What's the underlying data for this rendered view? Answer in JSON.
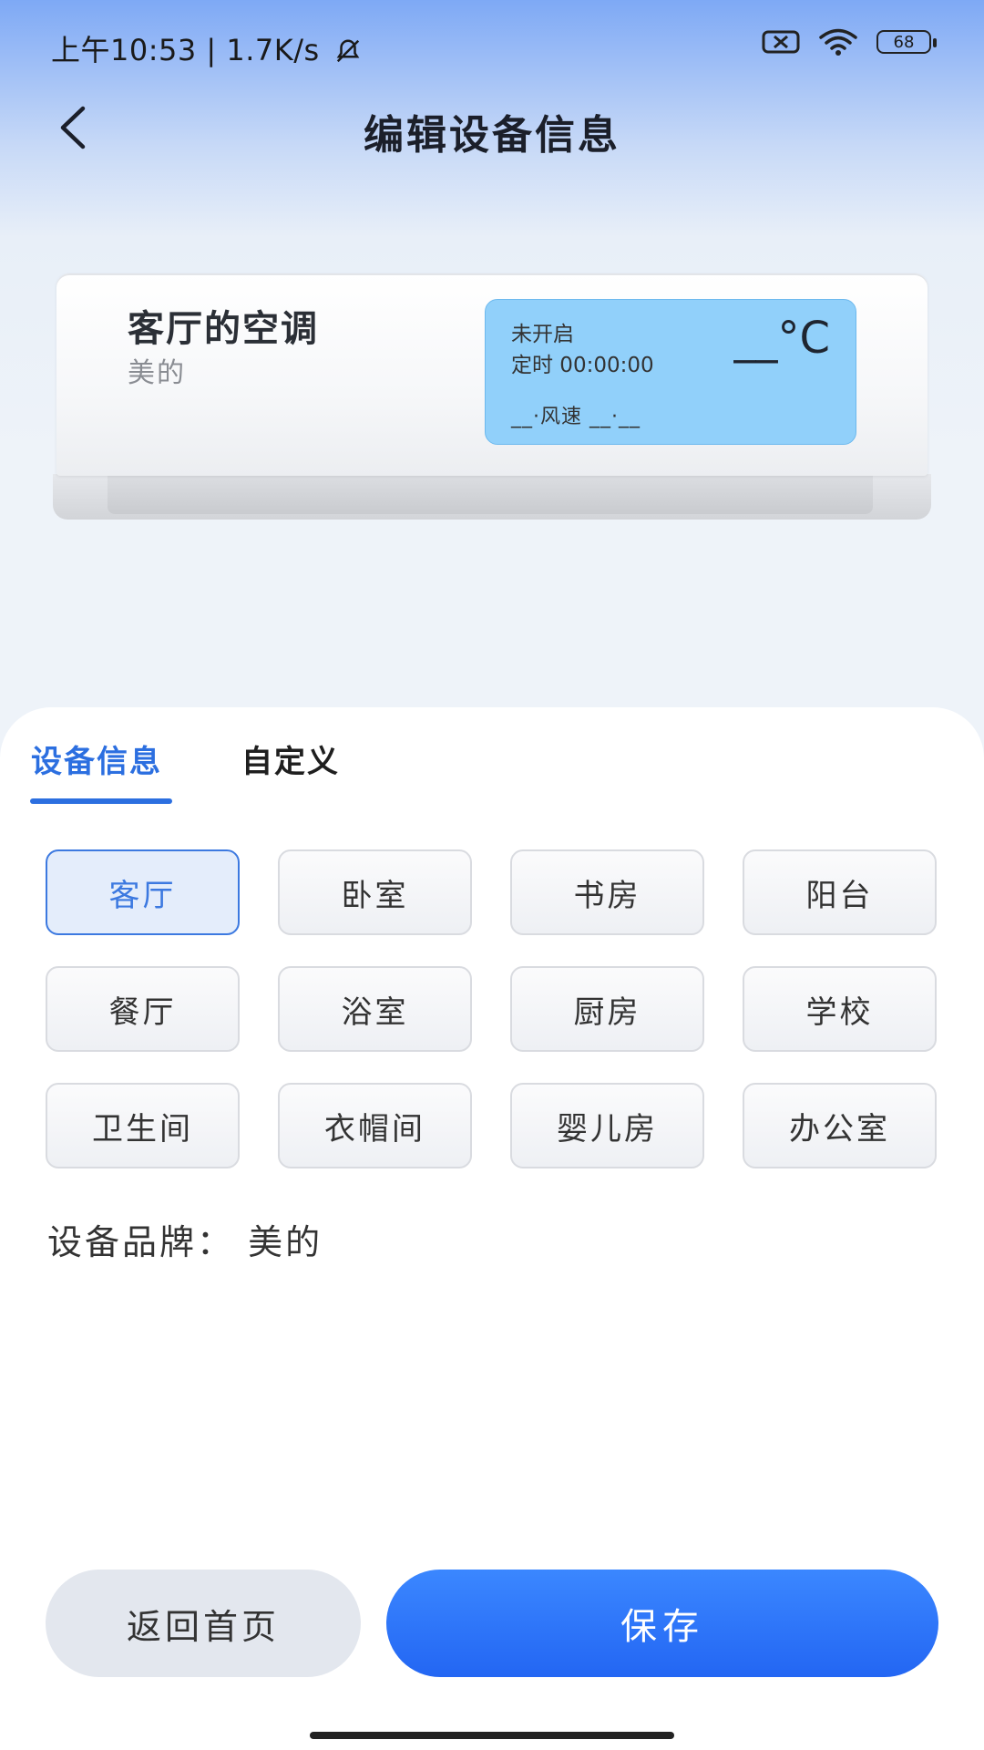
{
  "status_bar": {
    "time": "上午10:53 | 1.7K/s",
    "battery": "68"
  },
  "header": {
    "title": "编辑设备信息"
  },
  "device_card": {
    "name": "客厅的空调",
    "brand": "美的",
    "display": {
      "status": "未开启",
      "timer": "定时 00:00:00",
      "temperature": "__°C",
      "wind": "__·风速  __·__"
    }
  },
  "tabs": [
    {
      "label": "设备信息",
      "active": true
    },
    {
      "label": "自定义",
      "active": false
    }
  ],
  "rooms": [
    {
      "label": "客厅",
      "selected": true
    },
    {
      "label": "卧室",
      "selected": false
    },
    {
      "label": "书房",
      "selected": false
    },
    {
      "label": "阳台",
      "selected": false
    },
    {
      "label": "餐厅",
      "selected": false
    },
    {
      "label": "浴室",
      "selected": false
    },
    {
      "label": "厨房",
      "selected": false
    },
    {
      "label": "学校",
      "selected": false
    },
    {
      "label": "卫生间",
      "selected": false
    },
    {
      "label": "衣帽间",
      "selected": false
    },
    {
      "label": "婴儿房",
      "selected": false
    },
    {
      "label": "办公室",
      "selected": false
    }
  ],
  "brand_info": {
    "text": "设备品牌：  美的"
  },
  "actions": {
    "home_label": "返回首页",
    "save_label": "保存"
  },
  "colors": {
    "accent": "#2c6fe0",
    "save_button": "#2366f3",
    "display_bg": "#91d0fa"
  }
}
